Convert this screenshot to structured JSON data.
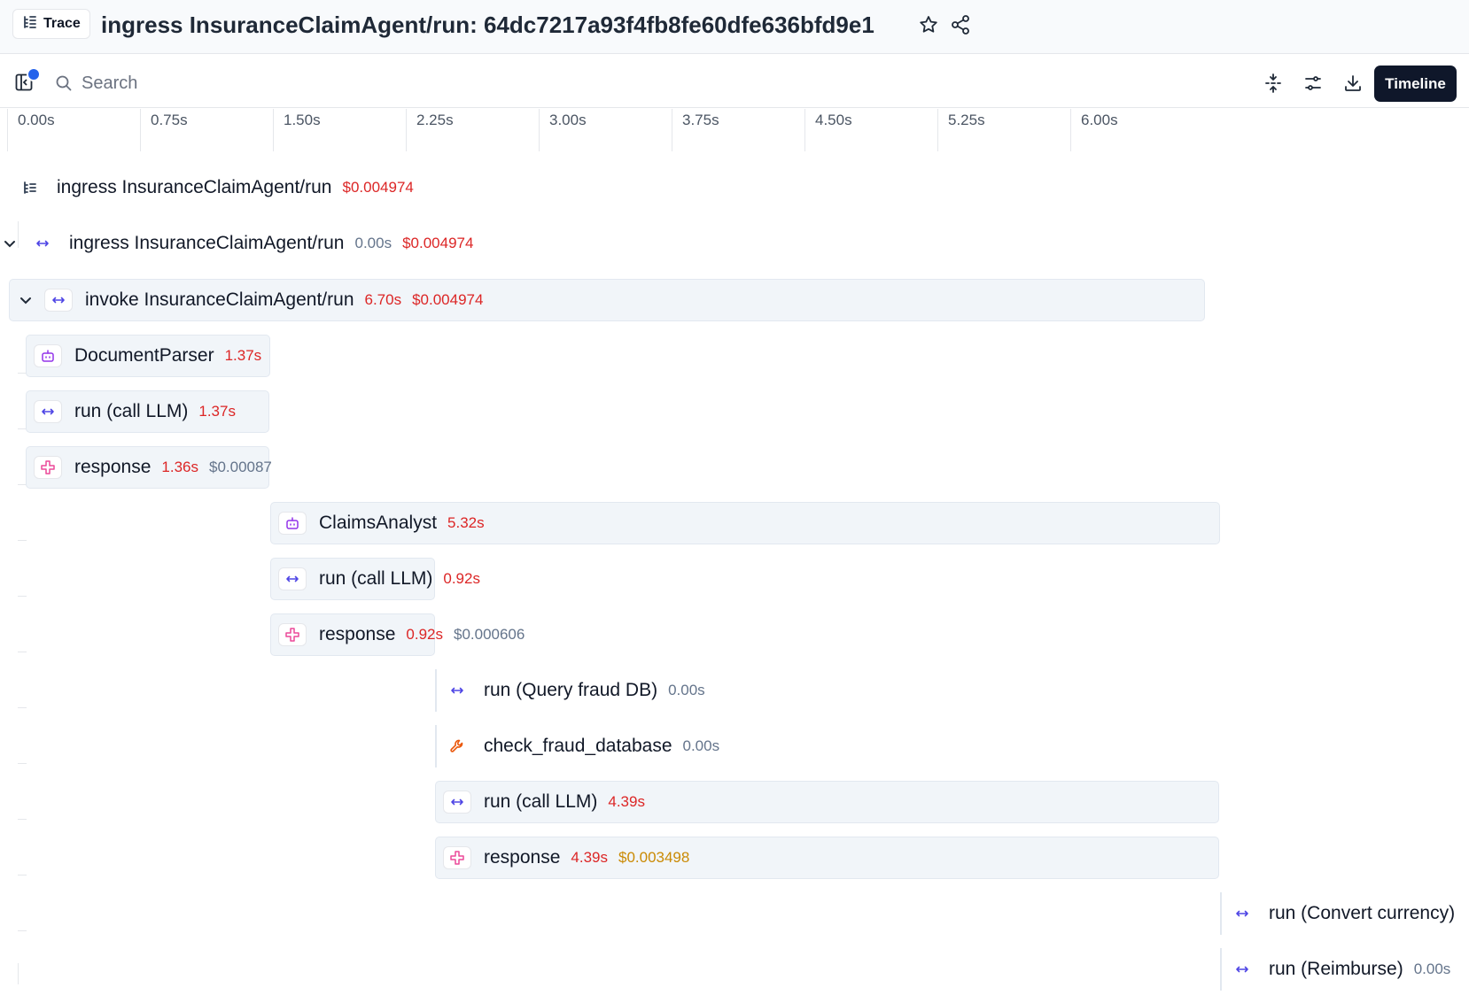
{
  "header": {
    "badge_label": "Trace",
    "title": "ingress InsuranceClaimAgent/run: 64dc7217a93f4fb8fe60dfe636bfd9e1"
  },
  "toolbar": {
    "search_placeholder": "Search",
    "timeline_label": "Timeline"
  },
  "timeline_ticks": [
    "0.00s",
    "0.75s",
    "1.50s",
    "2.25s",
    "3.00s",
    "3.75s",
    "4.50s",
    "5.25s",
    "6.00s"
  ],
  "colors": {
    "duration_red": "#dc2626",
    "duration_gray": "#64748b",
    "cost_red": "#dc2626",
    "cost_gray": "#64748b",
    "cost_amber": "#ca8a04",
    "accent_blue": "#2563eb"
  },
  "spans": [
    {
      "name": "ingress InsuranceClaimAgent/run",
      "duration": "",
      "cost": "$0.004974",
      "icon": "trace-icon"
    },
    {
      "name": "ingress InsuranceClaimAgent/run",
      "duration": "0.00s",
      "cost": "$0.004974",
      "icon": "span-arrows-icon"
    },
    {
      "name": "invoke InsuranceClaimAgent/run",
      "duration": "6.70s",
      "cost": "$0.004974",
      "icon": "span-arrows-icon"
    },
    {
      "name": "DocumentParser",
      "duration": "1.37s",
      "cost": "",
      "icon": "agent-robot-icon"
    },
    {
      "name": "run (call LLM)",
      "duration": "1.37s",
      "cost": "",
      "icon": "span-arrows-icon"
    },
    {
      "name": "response",
      "duration": "1.36s",
      "cost": "$0.00087",
      "icon": "llm-response-icon"
    },
    {
      "name": "ClaimsAnalyst",
      "duration": "5.32s",
      "cost": "",
      "icon": "agent-robot-icon"
    },
    {
      "name": "run (call LLM)",
      "duration": "0.92s",
      "cost": "",
      "icon": "span-arrows-icon"
    },
    {
      "name": "response",
      "duration": "0.92s",
      "cost": "$0.000606",
      "icon": "llm-response-icon"
    },
    {
      "name": "run (Query fraud DB)",
      "duration": "0.00s",
      "cost": "",
      "icon": "span-arrows-icon"
    },
    {
      "name": "check_fraud_database",
      "duration": "0.00s",
      "cost": "",
      "icon": "tool-wrench-icon"
    },
    {
      "name": "run (call LLM)",
      "duration": "4.39s",
      "cost": "",
      "icon": "span-arrows-icon"
    },
    {
      "name": "response",
      "duration": "4.39s",
      "cost": "$0.003498",
      "icon": "llm-response-icon"
    },
    {
      "name": "run (Convert currency)",
      "duration": "",
      "cost": "",
      "icon": "span-arrows-icon"
    },
    {
      "name": "run (Reimburse)",
      "duration": "0.00s",
      "cost": "",
      "icon": "span-arrows-icon"
    }
  ]
}
